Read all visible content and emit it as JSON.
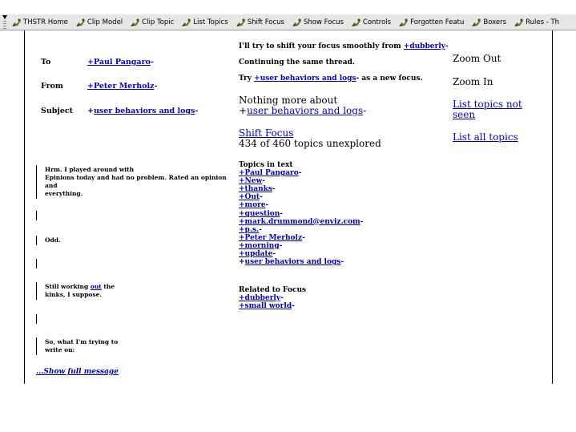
{
  "toolbar": {
    "items": [
      {
        "label": "THSTR Home",
        "icon": "fish-icon"
      },
      {
        "label": "Clip Model",
        "icon": "fish-icon"
      },
      {
        "label": "Clip Topic",
        "icon": "fish-icon"
      },
      {
        "label": "List Topics",
        "icon": "fish-icon"
      },
      {
        "label": "Shift Focus",
        "icon": "fish-icon"
      },
      {
        "label": "Show Focus",
        "icon": "fish-icon"
      },
      {
        "label": "Controls",
        "icon": "fish-icon"
      },
      {
        "label": "Forgotten Featu",
        "icon": "fish-icon"
      },
      {
        "label": "Boxers",
        "icon": "fish-icon"
      },
      {
        "label": "Rules - Th",
        "icon": "fish-icon"
      }
    ]
  },
  "message": {
    "to_label": "To",
    "to_value": "+Paul Pangaro",
    "from_label": "From",
    "from_value": "+Peter Merholz",
    "subject_label": "Subject",
    "subject_plus": "+",
    "subject_value": "user behaviors and logs",
    "dash": "-",
    "body": {
      "p1_line1": "Hrm. I played around with",
      "p1_line2": "Epinions today and had no problem. Rated an opinion",
      "p1_line3": "and",
      "p1_line4": "everything.",
      "p2": "Odd.",
      "p3_pre": "Still working ",
      "p3_link": "out",
      "p3_post": " the",
      "p3_line2": "kinks, I suppose.",
      "p4_line1": "So, what I'm trying to",
      "p4_line2": "write on:"
    },
    "show_full": "...Show full message"
  },
  "focus": {
    "shift_prefix": "I'll try to shift your focus smoothly from ",
    "shift_link": "+dubberly",
    "continuing": "Continuing the same thread.",
    "try_prefix": "Try ",
    "try_link": "+user behaviors and logs",
    "try_suffix": "- as a new focus.",
    "nothing_more": "Nothing more about",
    "nothing_plus": "+",
    "nothing_link": "user behaviors and logs",
    "shift_focus_link": "Shift Focus",
    "unexplored": "434 of 460 topics unexplored"
  },
  "topics": {
    "heading": "Topics in text",
    "items": [
      "+Paul Pangaro",
      "+New",
      "+thanks",
      "+Out",
      "+more",
      "+question",
      "+mark.drummond@enviz.com",
      "+p.s.",
      "+Peter Merholz",
      "+morning",
      "+update"
    ],
    "last_plus": "+",
    "last_link": "user behaviors and logs"
  },
  "related": {
    "heading": "Related to Focus",
    "items": [
      "+dubberly",
      "+small world"
    ]
  },
  "right": {
    "zoom_out": "Zoom Out",
    "zoom_in": "Zoom In",
    "list_not_seen": "List topics not seen",
    "list_all": "List all topics"
  },
  "colors": {
    "link": "#0000cc",
    "toolbar_bg": "#e6e6e6"
  }
}
